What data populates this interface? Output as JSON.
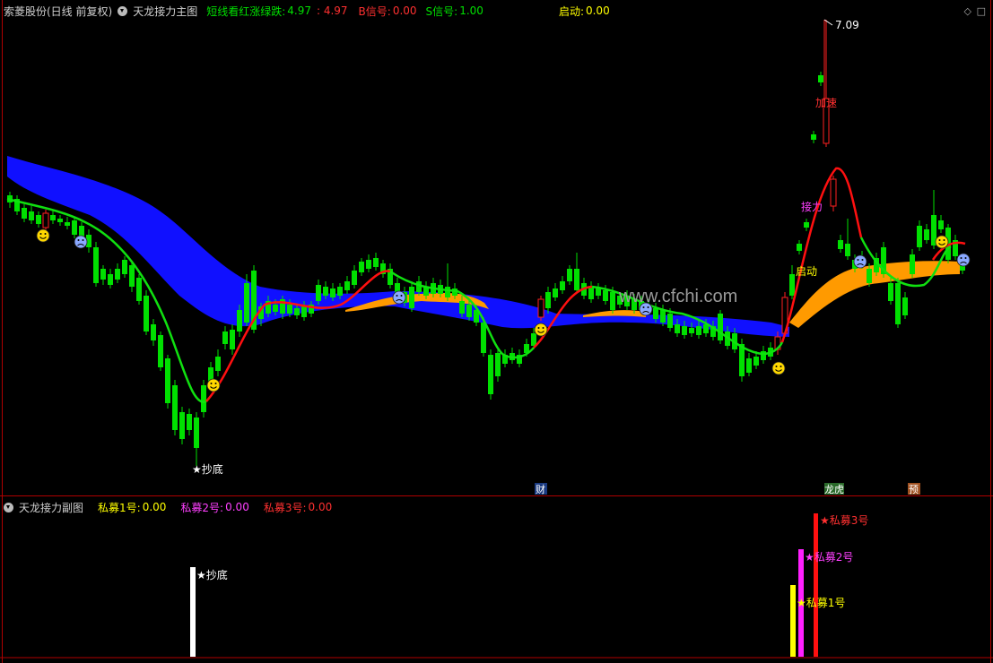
{
  "main_header": {
    "stock_name": "索菱股份(日线 前复权)",
    "indicator_name": "天龙接力主图",
    "label_short": "短线看红涨绿跌:",
    "value_short_1": "4.97",
    "value_short_2": ": 4.97",
    "label_b": "B信号:",
    "value_b": "0.00",
    "label_s": "S信号:",
    "value_s": "1.00",
    "label_start": "启动:",
    "value_start": "0.00"
  },
  "sub_header": {
    "indicator_name": "天龙接力副图",
    "label_1": "私募1号:",
    "value_1": "0.00",
    "label_2": "私募2号:",
    "value_2": "0.00",
    "label_3": "私募3号:",
    "value_3": "0.00"
  },
  "annotations": {
    "high_price": "7.09",
    "accelerate": "加速",
    "relay": "接力",
    "start": "启动",
    "bottom": "★抄底",
    "finance": "财",
    "dragon": "龙虎",
    "forecast": "预",
    "watermark": "www.cfchi.com"
  },
  "sub_annotations": {
    "bottom": "★抄底",
    "pm1": "★私募1号",
    "pm2": "★私募2号",
    "pm3": "★私募3号"
  },
  "window_controls": [
    "◇",
    "□"
  ],
  "colors": {
    "up": "#ff2020",
    "down": "#00e000",
    "band_blue": "#1010ff",
    "band_orange": "#ff9a00",
    "line_red": "#ff1010",
    "line_green": "#10e010",
    "yellow": "#ffff00",
    "magenta": "#ff20ff",
    "white": "#ffffff"
  }
}
